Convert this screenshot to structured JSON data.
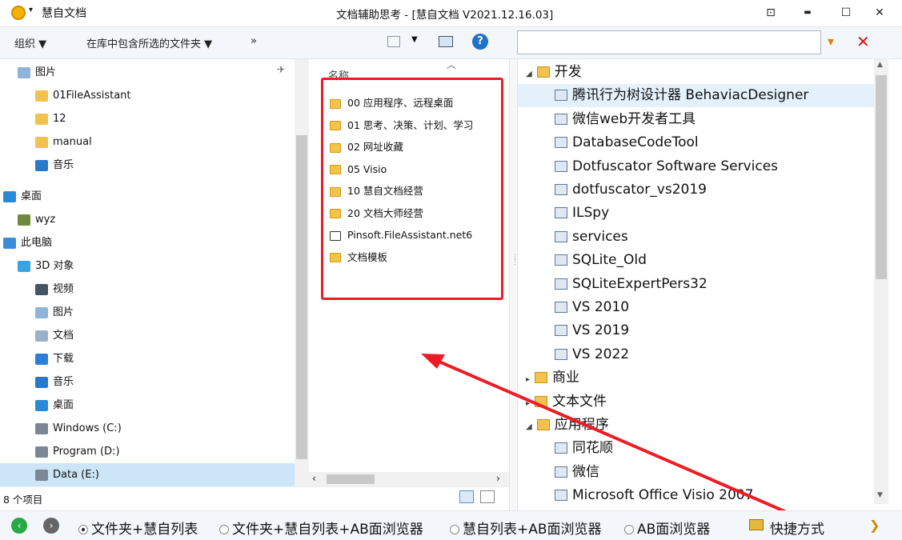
{
  "window": {
    "app_name": "慧自文档",
    "title": "文档辅助思考 - [慧自文档 V2021.12.16.03]",
    "controls": {
      "pin": "⊡",
      "minimize": "▬",
      "maximize": "☐",
      "close": "✕"
    }
  },
  "left_toolbar": {
    "organize_label": "组织 ▼",
    "include_label": "在库中包含所选的文件夹 ▼",
    "more_label": "»"
  },
  "search": {
    "value": "",
    "placeholder": ""
  },
  "nav": {
    "items": [
      {
        "label": "图片",
        "icon": "picture-icon"
      },
      {
        "label": "01FileAssistant",
        "icon": "folder-icon"
      },
      {
        "label": "12",
        "icon": "folder-icon"
      },
      {
        "label": "manual",
        "icon": "folder-icon"
      },
      {
        "label": "音乐",
        "icon": "music-icon"
      },
      {
        "label": "桌面",
        "icon": "desktop-icon"
      },
      {
        "label": "wyz",
        "icon": "user-icon"
      },
      {
        "label": "此电脑",
        "icon": "computer-icon"
      },
      {
        "label": "3D 对象",
        "icon": "cube-icon"
      },
      {
        "label": "视频",
        "icon": "video-icon"
      },
      {
        "label": "图片",
        "icon": "picture-icon"
      },
      {
        "label": "文档",
        "icon": "document-icon"
      },
      {
        "label": "下载",
        "icon": "download-icon"
      },
      {
        "label": "音乐",
        "icon": "music-icon"
      },
      {
        "label": "桌面",
        "icon": "desktop-icon"
      },
      {
        "label": "Windows (C:)",
        "icon": "drive-icon"
      },
      {
        "label": "Program (D:)",
        "icon": "drive-icon"
      },
      {
        "label": "Data (E:)",
        "icon": "drive-icon"
      }
    ]
  },
  "files": {
    "column_header": "名称",
    "items": [
      "00 应用程序、远程桌面",
      "01 思考、决策、计划、学习",
      "02 网址收藏",
      "05 Visio",
      "10 慧自文档经营",
      "20 文档大师经营",
      "Pinsoft.FileAssistant.net6",
      "文档模板"
    ]
  },
  "status": {
    "item_count": "8 个项目"
  },
  "tree": {
    "nodes": [
      {
        "label": "开发",
        "expander": "◢"
      },
      {
        "label": "腾讯行为树设计器 BehaviacDesigner"
      },
      {
        "label": "微信web开发者工具"
      },
      {
        "label": "DatabaseCodeTool"
      },
      {
        "label": "Dotfuscator Software Services"
      },
      {
        "label": "dotfuscator_vs2019"
      },
      {
        "label": "ILSpy"
      },
      {
        "label": "services"
      },
      {
        "label": "SQLite_Old"
      },
      {
        "label": "SQLiteExpertPers32"
      },
      {
        "label": "VS 2010"
      },
      {
        "label": "VS 2019"
      },
      {
        "label": "VS 2022"
      },
      {
        "label": "商业",
        "expander": "▸"
      },
      {
        "label": "文本文件",
        "expander": "▸"
      },
      {
        "label": "应用程序",
        "expander": "◢"
      },
      {
        "label": "同花顺"
      },
      {
        "label": "微信"
      },
      {
        "label": "Microsoft Office Visio 2007"
      }
    ]
  },
  "bottom": {
    "radios": [
      "文件夹+慧自列表",
      "文件夹+慧自列表+AB面浏览器",
      "慧自列表+AB面浏览器",
      "AB面浏览器"
    ],
    "shortcut_label": "快捷方式"
  },
  "colors": {
    "highlight_red": "#ec1c24",
    "selection_blue": "#cde6f7",
    "toolbar_bg": "#f3f6fb"
  }
}
